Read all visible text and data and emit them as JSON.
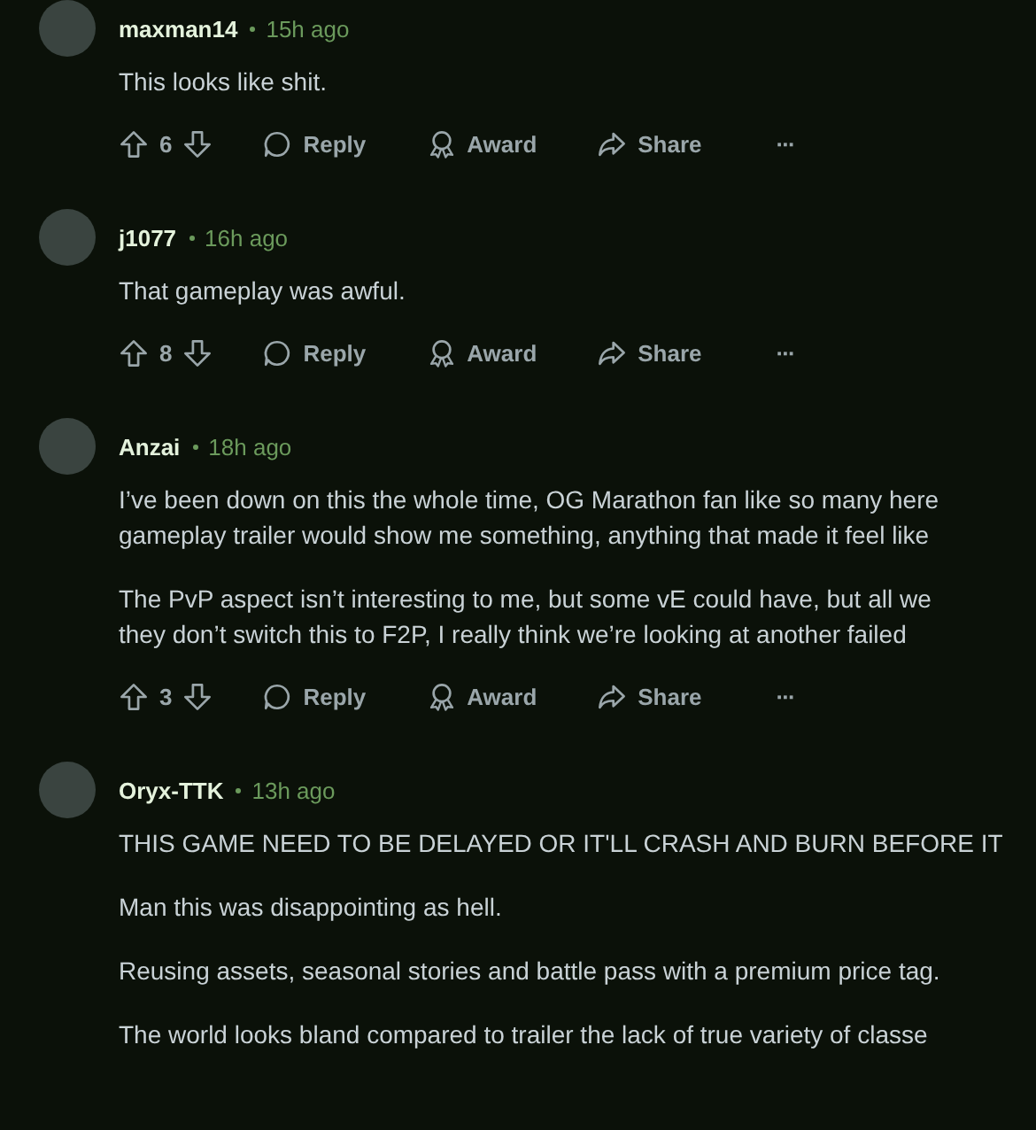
{
  "comments": [
    {
      "user": "maxman14",
      "time": "15h ago",
      "paragraphs": [
        [
          "This looks like shit."
        ]
      ],
      "actions": {
        "votes": "6",
        "reply": "Reply",
        "award": "Award",
        "share": "Share",
        "more": "···"
      }
    },
    {
      "user": "j1077",
      "time": "16h ago",
      "paragraphs": [
        [
          "That gameplay was awful."
        ]
      ],
      "actions": {
        "votes": "8",
        "reply": "Reply",
        "award": "Award",
        "share": "Share",
        "more": "···"
      }
    },
    {
      "user": "Anzai",
      "time": "18h ago",
      "paragraphs": [
        [
          "I’ve been down on this the whole time, OG Marathon fan like so many here",
          "gameplay trailer would show me something, anything that made it feel like"
        ],
        [
          "The PvP aspect isn’t interesting to me, but some vE could have, but all we",
          "they don’t switch this to F2P, I really think we’re looking at another failed"
        ]
      ],
      "actions": {
        "votes": "3",
        "reply": "Reply",
        "award": "Award",
        "share": "Share",
        "more": "···"
      }
    },
    {
      "user": "Oryx-TTK",
      "time": "13h ago",
      "paragraphs": [
        [
          "THIS GAME NEED TO BE DELAYED OR IT'LL CRASH AND BURN BEFORE IT"
        ],
        [
          "Man this was disappointing as hell."
        ],
        [
          "Reusing assets, seasonal stories and battle pass with a premium price tag."
        ],
        [
          "The world looks bland compared to trailer the lack of true variety of classe"
        ]
      ]
    }
  ]
}
